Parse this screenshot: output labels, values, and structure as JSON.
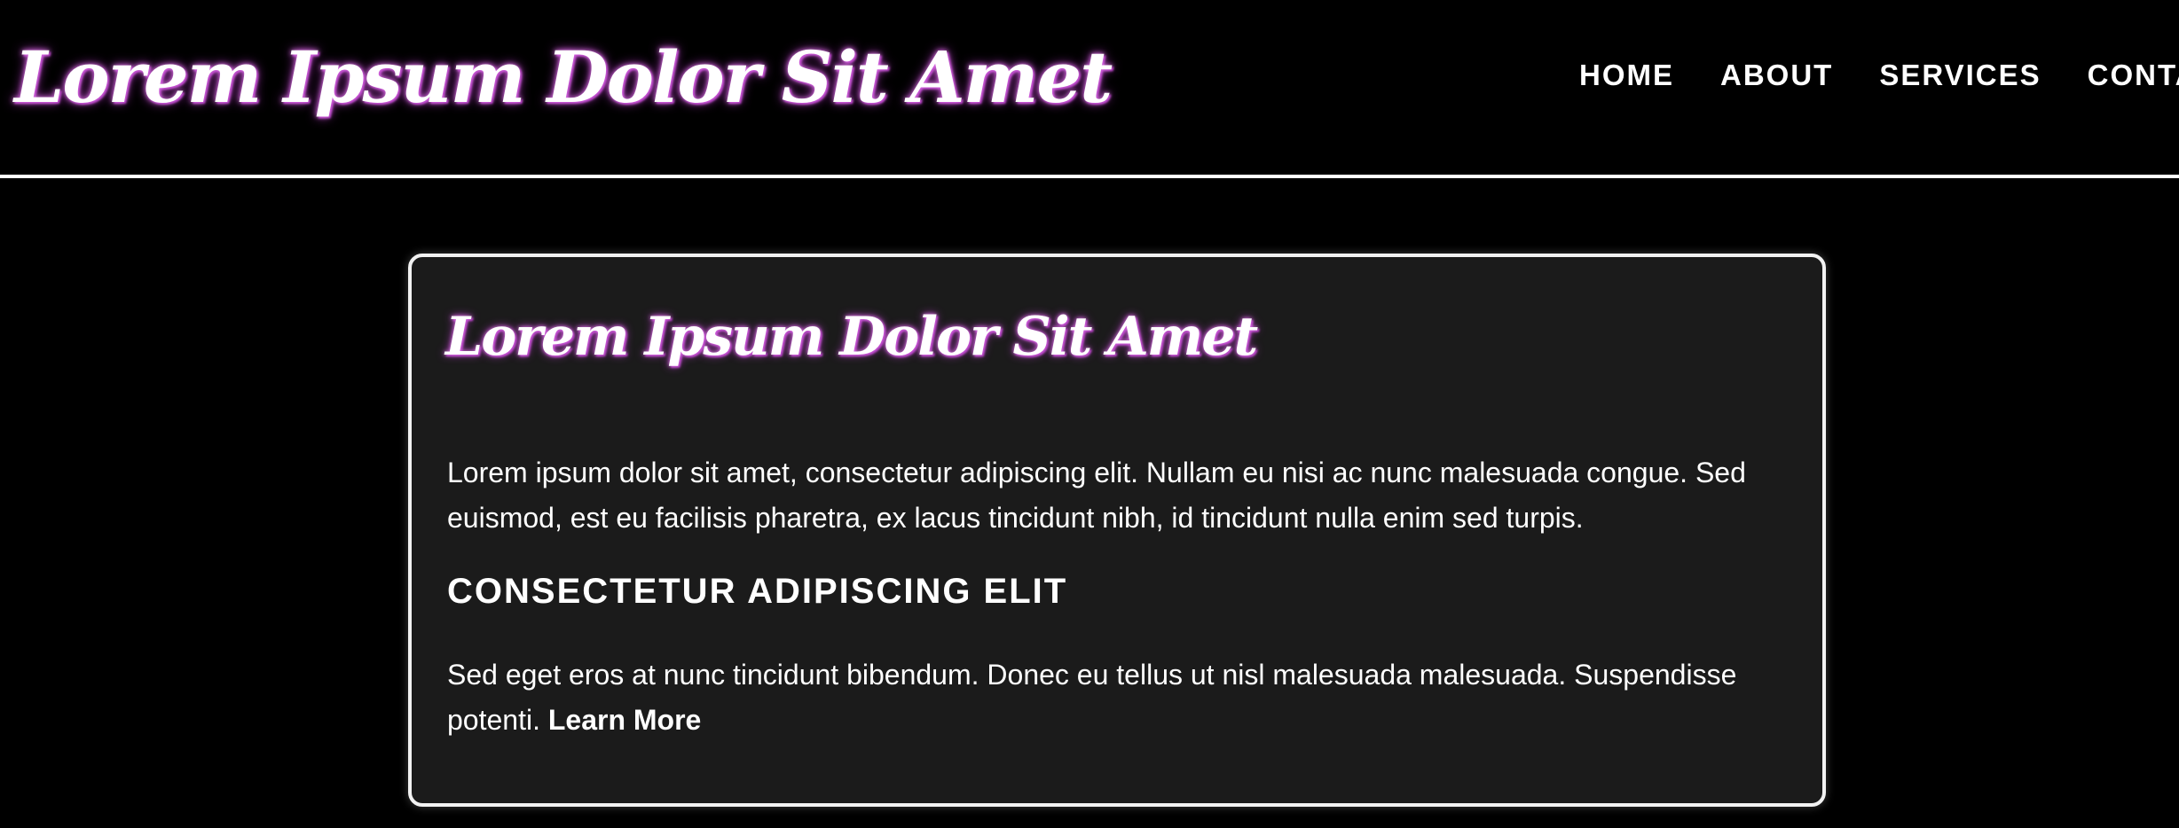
{
  "header": {
    "site_title": "Lorem Ipsum Dolor Sit Amet",
    "nav": [
      {
        "label": "HOME"
      },
      {
        "label": "ABOUT"
      },
      {
        "label": "SERVICES"
      },
      {
        "label": "CONTACT"
      }
    ]
  },
  "card": {
    "title": "Lorem Ipsum Dolor Sit Amet",
    "paragraph1": "Lorem ipsum dolor sit amet, consectetur adipiscing elit. Nullam eu nisi ac nunc malesuada congue. Sed euismod, est eu facilisis pharetra, ex lacus tincidunt nibh, id tincidunt nulla enim sed turpis.",
    "subheading": "CONSECTETUR ADIPISCING ELIT",
    "paragraph2": "Sed eget eros at nunc tincidunt bibendum. Donec eu tellus ut nisl malesuada malesuada. Suspendisse potenti.",
    "link_label": "Learn More"
  },
  "colors": {
    "background": "#000000",
    "card_background": "#1b1b1b",
    "title_glow": "#b43cc4",
    "text": "#ffffff"
  }
}
